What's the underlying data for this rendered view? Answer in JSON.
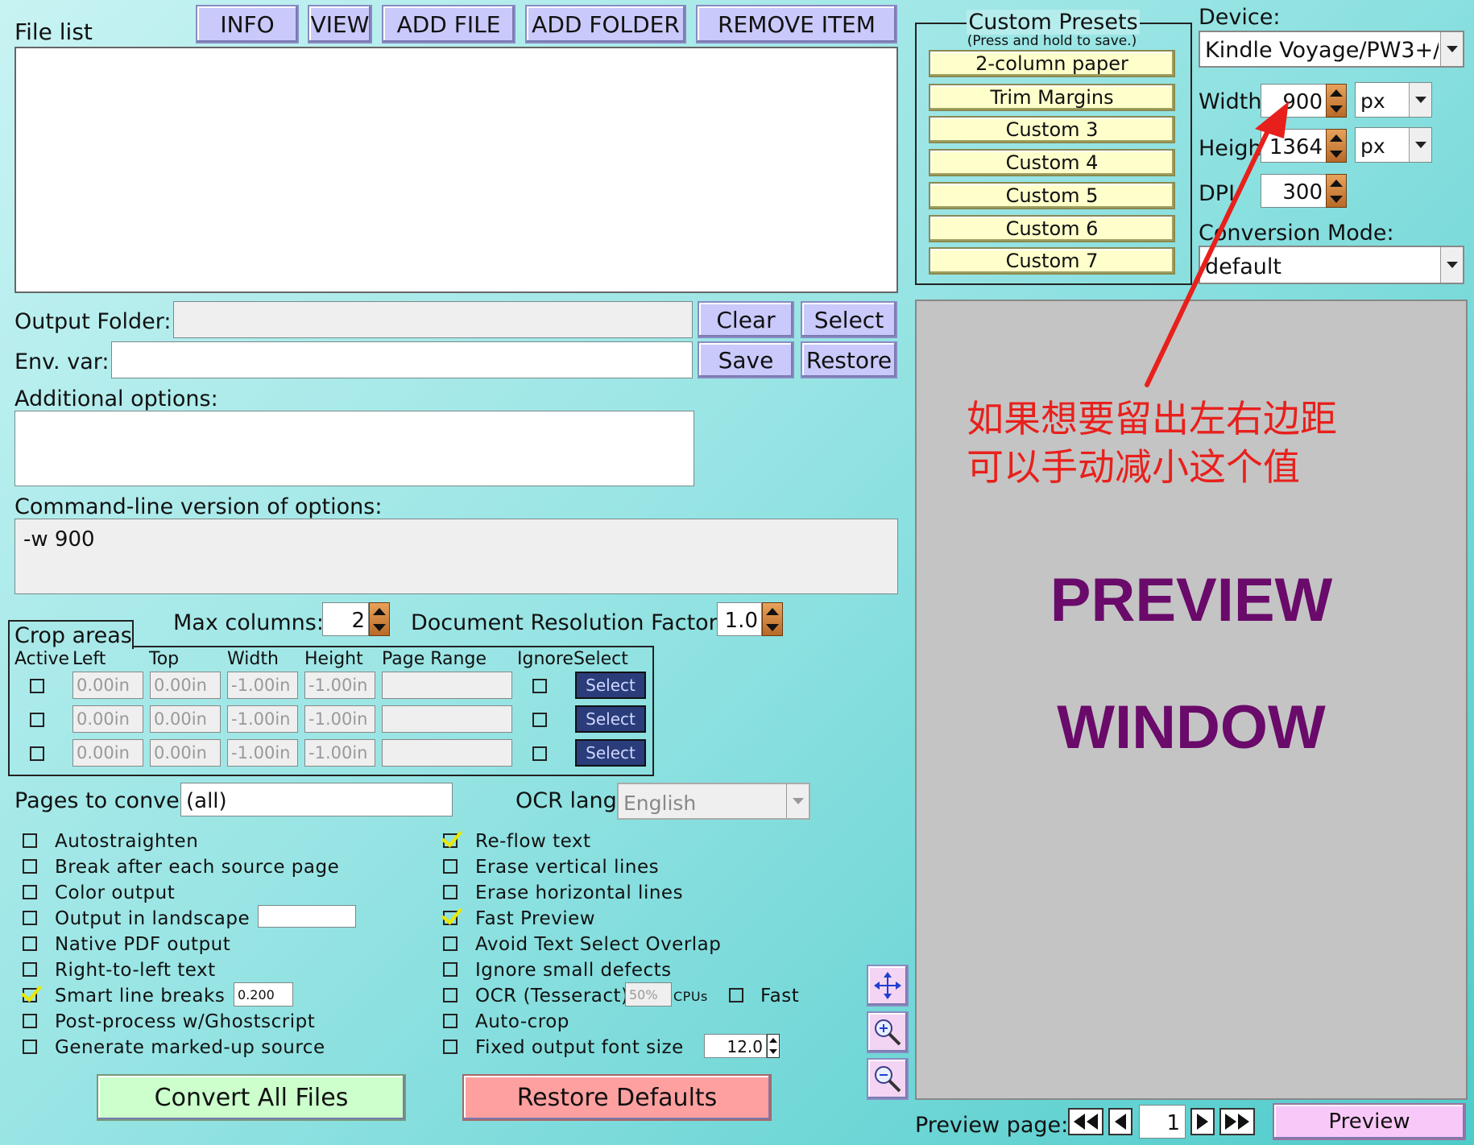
{
  "toolbar": {
    "file_list_label": "File list",
    "info": "INFO",
    "view": "VIEW",
    "add_file": "ADD FILE",
    "add_folder": "ADD FOLDER",
    "remove_item": "REMOVE ITEM"
  },
  "presets": {
    "title": "Custom Presets",
    "subtitle": "(Press and hold to save.)",
    "items": [
      "2-column paper",
      "Trim Margins",
      "Custom 3",
      "Custom 4",
      "Custom 5",
      "Custom 6",
      "Custom 7"
    ]
  },
  "device": {
    "label": "Device:",
    "value": "Kindle Voyage/PW3+/",
    "width_label": "Width",
    "width_value": "900",
    "width_unit": "px",
    "height_label": "Height",
    "height_value": "1364",
    "height_unit": "px",
    "dpi_label": "DPI",
    "dpi_value": "300",
    "mode_label": "Conversion Mode:",
    "mode_value": "default"
  },
  "output": {
    "folder_label": "Output Folder:",
    "folder_value": "",
    "clear": "Clear",
    "select": "Select",
    "env_label": "Env. var:",
    "env_value": "",
    "save": "Save",
    "restore": "Restore",
    "additional_label": "Additional options:",
    "cmdline_label": "Command-line version of options:",
    "cmdline_value": "-w 900"
  },
  "columns": {
    "max_label": "Max columns:",
    "max_value": "2",
    "resolution_label": "Document Resolution Factor:",
    "resolution_value": "1.0"
  },
  "crop": {
    "title": "Crop areas",
    "headers": [
      "Active",
      "Left",
      "Top",
      "Width",
      "Height",
      "Page Range",
      "Ignore",
      "Select"
    ],
    "rows": [
      {
        "left": "0.00in",
        "top": "0.00in",
        "width": "-1.00in",
        "height": "-1.00in",
        "range": "",
        "select": "Select"
      },
      {
        "left": "0.00in",
        "top": "0.00in",
        "width": "-1.00in",
        "height": "-1.00in",
        "range": "",
        "select": "Select"
      },
      {
        "left": "0.00in",
        "top": "0.00in",
        "width": "-1.00in",
        "height": "-1.00in",
        "range": "",
        "select": "Select"
      }
    ]
  },
  "pages": {
    "label": "Pages to convert:",
    "value": "(all)",
    "ocr_label": "OCR lang:",
    "ocr_value": "English"
  },
  "options_left": [
    {
      "label": "Autostraighten",
      "checked": false
    },
    {
      "label": "Break after each source page",
      "checked": false
    },
    {
      "label": "Color output",
      "checked": false
    },
    {
      "label": "Output in landscape",
      "checked": false
    },
    {
      "label": "Native PDF output",
      "checked": false
    },
    {
      "label": "Right-to-left text",
      "checked": false
    },
    {
      "label": "Smart line breaks",
      "checked": true,
      "value": "0.200"
    },
    {
      "label": "Post-process w/Ghostscript",
      "checked": false
    },
    {
      "label": "Generate marked-up source",
      "checked": false
    }
  ],
  "options_right": [
    {
      "label": "Re-flow text",
      "checked": true
    },
    {
      "label": "Erase vertical lines",
      "checked": false
    },
    {
      "label": "Erase horizontal lines",
      "checked": false
    },
    {
      "label": "Fast Preview",
      "checked": true
    },
    {
      "label": "Avoid Text Select Overlap",
      "checked": false
    },
    {
      "label": "Ignore small defects",
      "checked": false
    },
    {
      "label": "OCR (Tesseract)",
      "checked": false,
      "cpu_value": "50%",
      "cpu_label": "CPUs",
      "fast_label": "Fast"
    },
    {
      "label": "Auto-crop",
      "checked": false
    },
    {
      "label": "Fixed output font size",
      "checked": false,
      "value": "12.0"
    }
  ],
  "actions": {
    "convert": "Convert All Files",
    "restore_defaults": "Restore Defaults"
  },
  "preview": {
    "line1": "PREVIEW",
    "line2": "WINDOW",
    "page_label": "Preview page:",
    "page_value": "1",
    "button": "Preview"
  },
  "annotation": {
    "line1": "如果想要留出左右边距",
    "line2": "可以手动减小这个值",
    "color": "#e8201c"
  },
  "colors": {
    "button_bg": "#c9c9fb",
    "preset_bg": "#ffffcc",
    "convert_bg": "#ccffcc",
    "restore_bg": "#ffa0a0",
    "preview_text": "#6a0a6a",
    "preview_bg": "#c4c4c4"
  }
}
